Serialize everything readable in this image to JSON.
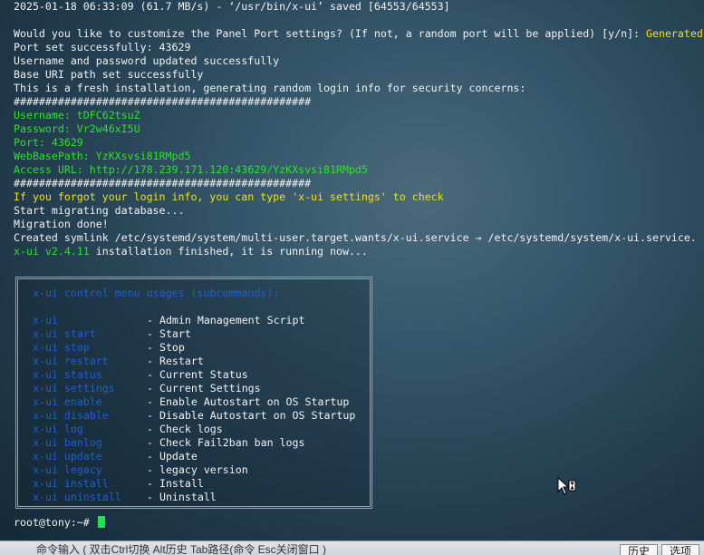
{
  "terminal": {
    "lines": [
      {
        "text": "2025-01-18 06:33:09 (61.7 MB/s) - ‘/usr/bin/x-ui’ saved [64553/64553]",
        "color": "#f2f2f2"
      },
      {
        "text": "",
        "color": "#f2f2f2"
      },
      {
        "text": "Would you like to customize the Panel Port settings? (If not, a random port will be applied) [y/n]: ",
        "color": "#f2f2f2",
        "suffix": "Generated"
      },
      {
        "text": "Port set successfully: 43629",
        "color": "#f2f2f2"
      },
      {
        "text": "Username and password updated successfully",
        "color": "#f2f2f2"
      },
      {
        "text": "Base URI path set successfully",
        "color": "#f2f2f2"
      },
      {
        "text": "This is a fresh installation, generating random login info for security concerns:",
        "color": "#f2f2f2"
      },
      {
        "text": "###############################################",
        "color": "#f2f2f2"
      },
      {
        "text": "Username: tDFC62tsuZ",
        "color": "#2ee02e"
      },
      {
        "text": "Password: Vr2w46xI5U",
        "color": "#2ee02e"
      },
      {
        "text": "Port: 43629",
        "color": "#2ee02e"
      },
      {
        "text": "WebBasePath: YzKXsvsi81RMpd5",
        "color": "#2ee02e"
      },
      {
        "text": "Access URL: http://178.239.171.120:43629/YzKXsvsi81RMpd5",
        "color": "#2ee02e"
      },
      {
        "text": "###############################################",
        "color": "#f2f2f2"
      },
      {
        "text": "If you forgot your login info, you can type 'x-ui settings' to check",
        "color": "#f0e020"
      },
      {
        "text": "Start migrating database...",
        "color": "#f2f2f2"
      },
      {
        "text": "Migration done!",
        "color": "#f2f2f2"
      },
      {
        "text": "Created symlink /etc/systemd/system/multi-user.target.wants/x-ui.service → /etc/systemd/system/x-ui.service.",
        "color": "#f2f2f2"
      },
      {
        "text": "x-ui v2.4.11",
        "color": "#2ee02e",
        "suffix_white": " installation finished, it is running now..."
      }
    ],
    "suffix_color": "#f0e020"
  },
  "menu": {
    "title": "x-ui control menu usages (subcommands):",
    "items": [
      {
        "cmd": "x-ui",
        "desc": "- Admin Management Script"
      },
      {
        "cmd": "x-ui start",
        "desc": "- Start"
      },
      {
        "cmd": "x-ui stop",
        "desc": "- Stop"
      },
      {
        "cmd": "x-ui restart",
        "desc": "- Restart"
      },
      {
        "cmd": "x-ui status",
        "desc": "- Current Status"
      },
      {
        "cmd": "x-ui settings",
        "desc": "- Current Settings"
      },
      {
        "cmd": "x-ui enable",
        "desc": "- Enable Autostart on OS Startup"
      },
      {
        "cmd": "x-ui disable",
        "desc": "- Disable Autostart on OS Startup"
      },
      {
        "cmd": "x-ui log",
        "desc": "- Check logs"
      },
      {
        "cmd": "x-ui banlog",
        "desc": "- Check Fail2ban ban logs"
      },
      {
        "cmd": "x-ui update",
        "desc": "- Update"
      },
      {
        "cmd": "x-ui legacy",
        "desc": "- legacy version"
      },
      {
        "cmd": "x-ui install",
        "desc": "- Install"
      },
      {
        "cmd": "x-ui uninstall",
        "desc": "- Uninstall"
      }
    ],
    "cmd_color": "#1f5fd0"
  },
  "prompt": {
    "text": "root@tony:~#"
  },
  "command_bar": {
    "input_placeholder": "命令输入 ( 双击Ctrl切换 Alt历史 Tab路径(命令 Esc关闭窗口 )",
    "history_label": "历史",
    "options_label": "选项"
  },
  "cursor_icon": "mouse-pointer-busy-icon",
  "colors": {
    "background": "#2a4658",
    "text": "#f2f2f2",
    "green": "#2ee02e",
    "yellow": "#f0e020",
    "blue": "#1f5fd0",
    "cursor": "#1ee05a"
  }
}
